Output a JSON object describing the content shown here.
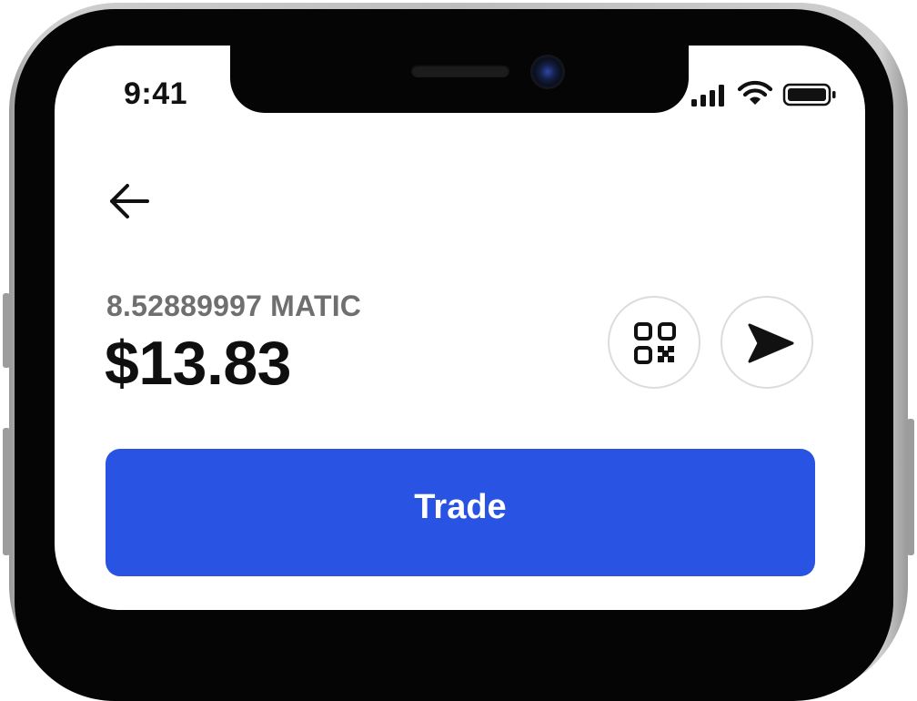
{
  "status_bar": {
    "time": "9:41",
    "icons": [
      "cellular-signal-icon",
      "wifi-icon",
      "battery-icon"
    ]
  },
  "nav": {
    "back_icon": "arrow-left-icon"
  },
  "asset": {
    "crypto_amount": "8.52889997 MATIC",
    "fiat_balance": "$13.83"
  },
  "actions": {
    "receive_icon": "qr-code-icon",
    "send_icon": "send-icon"
  },
  "trade_button": {
    "label": "Trade"
  },
  "colors": {
    "accent": "#2953e3",
    "primary_text": "#0f0f0f",
    "secondary_text": "#6f6f6f",
    "circle_border": "#dcdcdc"
  }
}
